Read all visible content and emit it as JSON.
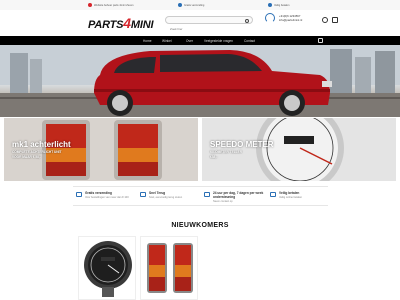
{
  "topbar": {
    "items": [
      {
        "label": "Website beheer parts 4mini Zeven"
      },
      {
        "label": "Gratis verzending"
      },
      {
        "label": "Veilig betalen"
      }
    ]
  },
  "header": {
    "logo_part1": "PARTS",
    "logo_part2": "4",
    "logo_part3": "MINI",
    "search_placeholder": "Zoek hier",
    "phone": "+31(0)6 1234567",
    "email": "info@parts4mini.nl"
  },
  "nav": {
    "items": [
      {
        "label": "Home"
      },
      {
        "label": "Winkel"
      },
      {
        "label": "Over"
      },
      {
        "label": "Veelgestelde vragen"
      },
      {
        "label": "Contact"
      }
    ]
  },
  "promos": [
    {
      "title": "mk1 achterlicht",
      "line1": "COMPLETE ACHTERLICHT UNIT",
      "line2": "VOOR MAAR € 58,-"
    },
    {
      "title": "SPEEDO METER",
      "line1": "KILOMETER TELLER",
      "line2": "€58,-"
    }
  ],
  "usps": [
    {
      "title": "Gratis verzending",
      "desc": "Voor bestellingen van meer dan € 100"
    },
    {
      "title": "Snel Terug",
      "desc": "Snel, eenvoudig terug sturen"
    },
    {
      "title": "24 uur per dag, 7 dagen per week ondersteuning",
      "desc": "Neem contact op"
    },
    {
      "title": "Veilig betalen",
      "desc": "Veilig online betalen"
    }
  ],
  "section": {
    "title": "NIEUWKOMERS"
  },
  "colors": {
    "accent": "#d7262d",
    "nav_bg": "#000000",
    "icon_blue": "#2a6fb5"
  }
}
